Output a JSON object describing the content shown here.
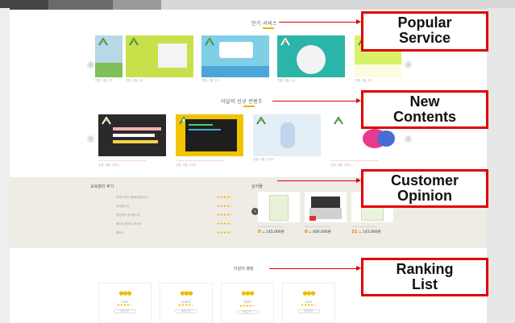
{
  "sections": {
    "popular_title": "인기 서비스",
    "new_title": "이달의 신규 컨텐츠",
    "review_title": "교육정리 후기",
    "store_title": "상지몰",
    "ranking_title": "이달의 랭킹"
  },
  "callouts": {
    "popular": "Popular\nService",
    "new": "New\nContents",
    "opinion": "Customer\nOpinion",
    "ranking": "Ranking\nList"
  },
  "popular_cards": [
    {
      "meta": "인원: 2월, 2주"
    },
    {
      "meta": "인원: 2월, 2주"
    },
    {
      "meta": "인원: 2월, 2주"
    },
    {
      "meta": "인원: 2월, 2주"
    },
    {
      "meta": "인원: 2월, 2주"
    }
  ],
  "new_cards": [
    {
      "meta": "인원: 2월, 2주차"
    },
    {
      "meta": "인원: 2월, 2주차"
    },
    {
      "meta": "인원: 2월, 2주차"
    },
    {
      "meta": "인원: 2월, 2주차"
    }
  ],
  "reviews": [
    {
      "text": "주택그리와 재배하였습니다",
      "stars": "★★★★☆"
    },
    {
      "text": "감사합니다",
      "stars": "★★★★☆"
    },
    {
      "text": "좋은정보 감사합니다",
      "stars": "★★★★☆"
    },
    {
      "text": "좋아요 좋아요 좋아요",
      "stars": "★★★★☆"
    },
    {
      "text": "좋아요",
      "stars": "★★★★☆"
    }
  ],
  "products": [
    {
      "pct": "0",
      "price": "145,000원"
    },
    {
      "pct": "0",
      "price": "400,000원"
    },
    {
      "pct": "21",
      "price": "145,000원"
    }
  ],
  "rankings": [
    {
      "name": "2020",
      "stars": "★★★★☆",
      "btn": "바로가기"
    },
    {
      "name": "SHARE",
      "stars": "★★★★☆",
      "btn": "바로가기"
    },
    {
      "name": "컨텐츠",
      "stars": "★★★★☆",
      "btn": "바로가기"
    },
    {
      "name": "2021",
      "stars": "★★★★☆",
      "btn": "바로가기"
    }
  ],
  "colors": {
    "accent": "#e8b400",
    "callout_red": "#e00000",
    "opinion_bg": "#efece5",
    "discount": "#e87b00"
  }
}
